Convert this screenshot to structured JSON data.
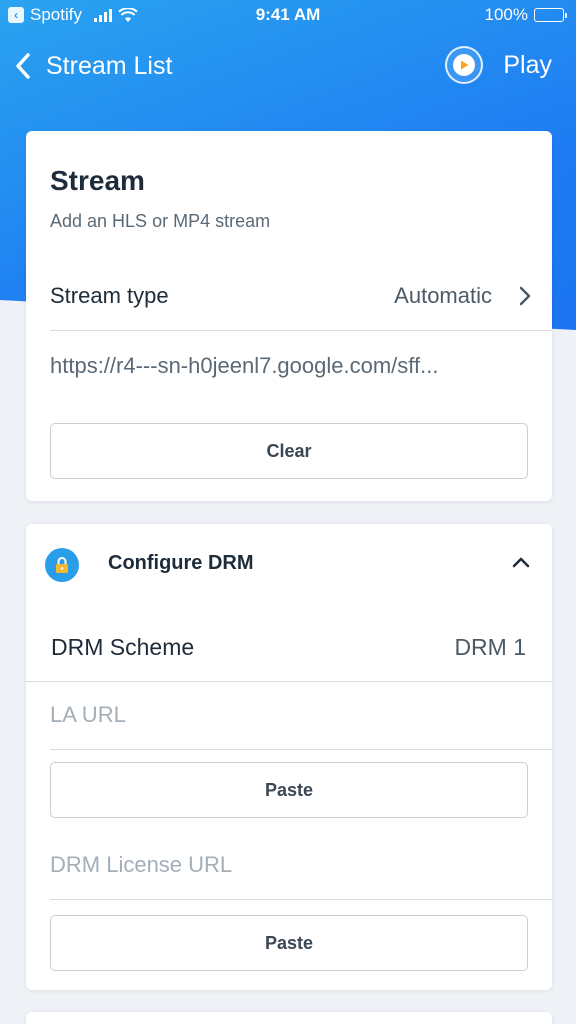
{
  "status_bar": {
    "carrier_back": "Spotify",
    "time": "9:41 AM",
    "battery": "100%"
  },
  "nav": {
    "back_label": "Stream List",
    "play_label": "Play"
  },
  "stream_card": {
    "title": "Stream",
    "subtitle": "Add an HLS or MP4 stream",
    "stream_type_label": "Stream type",
    "stream_type_value": "Automatic",
    "url": "https://r4---sn-h0jeenl7.google.com/sff...",
    "clear_label": "Clear"
  },
  "drm_card": {
    "title": "Configure DRM",
    "scheme_label": "DRM Scheme",
    "scheme_value": "DRM 1",
    "la_url_placeholder": "LA URL",
    "license_url_placeholder": "DRM License URL",
    "paste_label": "Paste"
  },
  "colors": {
    "brand_blue": "#1e7cf2",
    "accent_orange": "#f5a623"
  },
  "icons": [
    "back-chevron-icon",
    "wifi-icon",
    "battery-icon",
    "play-icon",
    "chevron-right-icon",
    "lock-icon",
    "chevron-up-icon"
  ]
}
